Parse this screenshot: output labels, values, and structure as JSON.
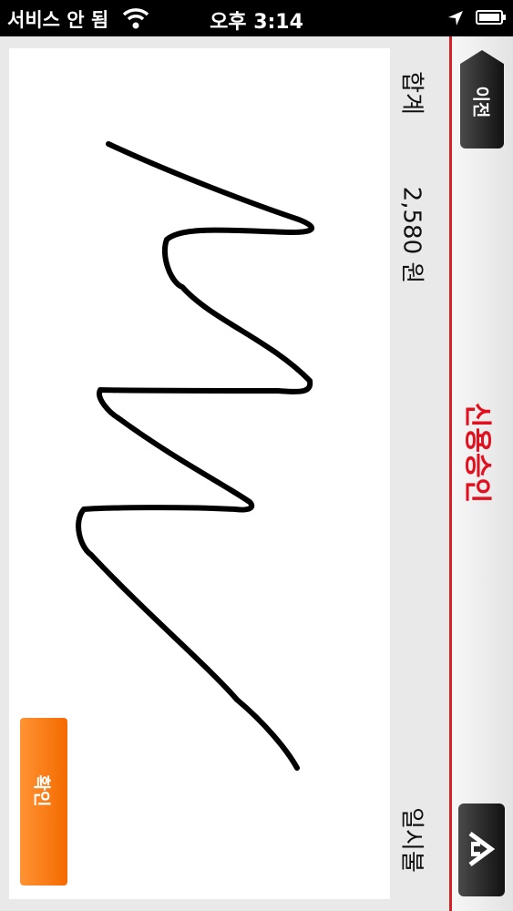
{
  "status_bar": {
    "carrier": "서비스 안 됨",
    "time": "오후 3:14"
  },
  "nav": {
    "back_label": "이전",
    "title": "신용승인"
  },
  "summary": {
    "total_label": "합계",
    "total_value": "2,580 원",
    "date_label": "일시불"
  },
  "signature": {
    "confirm_label": "확인"
  },
  "colors": {
    "accent_red": "#e2101e",
    "confirm_orange": "#f47a10",
    "nav_button_dark": "#1a1a1a"
  },
  "icons": [
    "wifi-icon",
    "location-arrow-icon",
    "battery-icon",
    "home-icon"
  ]
}
